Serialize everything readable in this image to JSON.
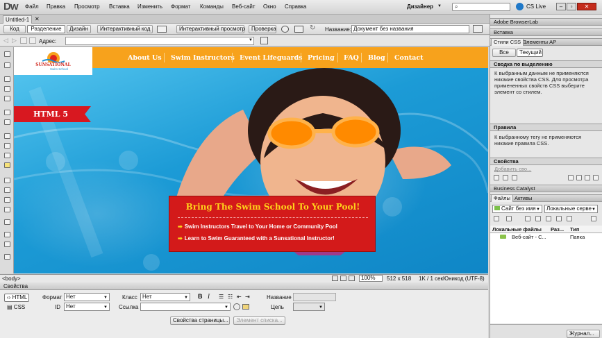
{
  "app": {
    "logo": "Dw",
    "menu": [
      "Файл",
      "Правка",
      "Просмотр",
      "Вставка",
      "Изменить",
      "Формат",
      "Команды",
      "Веб-сайт",
      "Окно",
      "Справка"
    ],
    "workspace": "Дизайнер",
    "cs_live": "CS Live"
  },
  "document": {
    "tab": "Untitled-1",
    "view_buttons": [
      "Код",
      "Разделение",
      "Дизайн",
      "Интерактивный код",
      "Интерактивный просмотр",
      "Проверка"
    ],
    "title_label": "Название:",
    "title_value": "Документ без названия",
    "address_label": "Адрес:"
  },
  "site": {
    "logo_name": "SUNSATIONAL",
    "logo_sub": "Swim School",
    "nav": [
      "About Us",
      "Swim Instructors",
      "Event Lifeguards",
      "Pricing",
      "FAQ",
      "Blog",
      "Contact"
    ],
    "ribbon": "HTML 5",
    "promo_title": "Bring The Swim School To Your Pool!",
    "promo_lines": [
      "Swim Instructors Travel to Your Home or Community Pool",
      "Learn to Swim Guaranteed with a Sunsational Instructor!"
    ]
  },
  "status": {
    "tag": "<body>",
    "zoom": "100%",
    "size": "512 x 518",
    "file_info": "1K / 1 сек",
    "encoding": "Юникод (UTF-8)"
  },
  "properties": {
    "panel_title": "Свойства",
    "html_btn": "HTML",
    "css_btn": "CSS",
    "format_label": "Формат",
    "format_value": "Нет",
    "class_label": "Класс",
    "class_value": "Нет",
    "id_label": "ID",
    "id_value": "Нет",
    "link_label": "Ссылка",
    "name_label": "Название",
    "target_label": "Цель",
    "bold": "B",
    "italic": "I",
    "page_props_btn": "Свойства страницы...",
    "list_item_btn": "Элемент списка..."
  },
  "right_panel": {
    "browserlab": "Adobe BrowserLab",
    "insert": "Вставка",
    "css_styles_tab": "Стили CSS",
    "ap_elements_tab": "Элементы AP",
    "all_btn": "Все",
    "current_btn": "Текущий",
    "summary_title": "Сводка по выделению",
    "summary_text": "К выбранным данным не применяются никакие свойства CSS.  Для просмотра примененных свойств CSS выберите элемент со стилем.",
    "rules_title": "Правила",
    "rules_text": "К выбранному тегу не применяются никакие правила CSS.",
    "props_title": "Свойства",
    "add_prop": "Добавить сво...",
    "business_catalyst": "Business Catalyst",
    "files_tab": "Файлы",
    "assets_tab": "Активы",
    "site_select": "Сайт без имя",
    "view_select": "Локальные серве",
    "col_local": "Локальные файлы",
    "col_size": "Раз...",
    "col_type": "Тип",
    "file_row_name": "Веб-сайт - С...",
    "file_row_type": "Папка",
    "log_btn": "Журнал..."
  },
  "colors": {
    "header_orange": "#f7a21c",
    "ribbon_red": "#d81820",
    "promo_red": "#d31a1a",
    "promo_title_yellow": "#ffd21a"
  }
}
